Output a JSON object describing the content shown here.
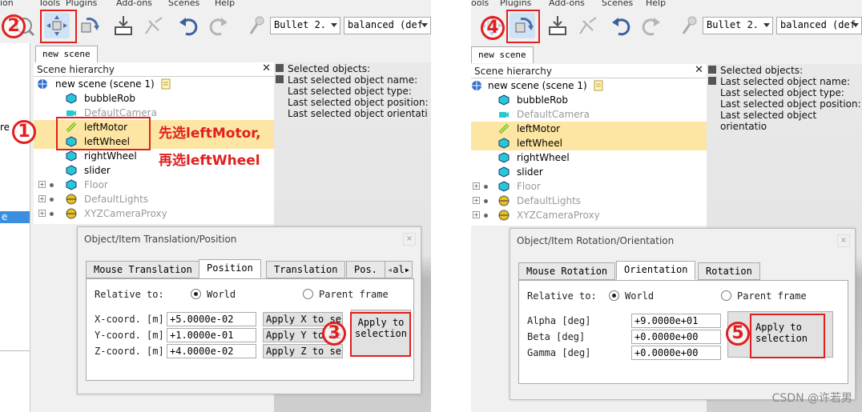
{
  "left": {
    "menu": [
      "ion",
      "Tools",
      "Plugins",
      "Add-ons",
      "Scenes",
      "Help"
    ],
    "toolbar": {
      "engine": "Bullet 2.",
      "mode": "balanced (def"
    },
    "scene_tab": "new scene",
    "hierarchy": {
      "title": "Scene hierarchy",
      "root": "new scene (scene 1)",
      "items": [
        "bubbleRob",
        "DefaultCamera",
        "leftMotor",
        "leftWheel",
        "rightWheel",
        "slider",
        "Floor",
        "DefaultLights",
        "XYZCameraProxy"
      ]
    },
    "side_fragments": [
      "re",
      "e"
    ],
    "viewport_info": [
      "Selected objects:",
      "Last selected object name:",
      "Last selected object type:",
      "Last selected object position:",
      "Last selected object orientati"
    ],
    "annotations": {
      "n1": "1",
      "n2": "2",
      "n3": "3",
      "line1": "先选leftMotor,",
      "line2": "再选leftWheel"
    },
    "dialog": {
      "title": "Object/Item Translation/Position",
      "close": "×",
      "tabs": [
        "Mouse Translation",
        "Position",
        "Translation",
        "Pos."
      ],
      "tab_extra": "al",
      "relative_to": "Relative to:",
      "world": "World",
      "parent_frame": "Parent frame",
      "coords": [
        {
          "label": "X-coord. [m]",
          "value": "+5.0000e-02",
          "apply": "Apply X to sel"
        },
        {
          "label": "Y-coord. [m]",
          "value": "+1.0000e-01",
          "apply": "Apply Y to sel"
        },
        {
          "label": "Z-coord. [m]",
          "value": "+4.0000e-02",
          "apply": "Apply Z to sel"
        }
      ],
      "apply_btn_line1": "Apply to",
      "apply_btn_line2": "selection"
    }
  },
  "right": {
    "menu": [
      "ools",
      "Plugins",
      "Add-ons",
      "Scenes",
      "Help"
    ],
    "toolbar": {
      "engine": "Bullet 2.",
      "mode": "balanced (def"
    },
    "scene_tab": "new scene",
    "hierarchy": {
      "title": "Scene hierarchy",
      "root": "new scene (scene 1)",
      "items": [
        "bubbleRob",
        "DefaultCamera",
        "leftMotor",
        "leftWheel",
        "rightWheel",
        "slider",
        "Floor",
        "DefaultLights",
        "XYZCameraProxy"
      ]
    },
    "viewport_info": [
      "Selected objects:",
      "Last selected object name:",
      "Last selected object type:",
      "Last selected object position:",
      "Last selected object orientatio"
    ],
    "annotations": {
      "n4": "4",
      "n5": "5"
    },
    "dialog": {
      "title": "Object/Item Rotation/Orientation",
      "close": "×",
      "tabs": [
        "Mouse Rotation",
        "Orientation",
        "Rotation"
      ],
      "relative_to": "Relative to:",
      "world": "World",
      "parent_frame": "Parent frame",
      "angles": [
        {
          "label": "Alpha [deg]",
          "value": "+9.0000e+01"
        },
        {
          "label": "Beta [deg]",
          "value": "+0.0000e+00"
        },
        {
          "label": "Gamma [deg]",
          "value": "+0.0000e+00"
        }
      ],
      "apply_btn_line1": "Apply to",
      "apply_btn_line2": "selection"
    },
    "watermark": "CSDN @许若男"
  },
  "colors": {
    "annotation": "#e02020",
    "highlight_row": "#fde6a3",
    "object_cyan": "#28c8d0"
  }
}
